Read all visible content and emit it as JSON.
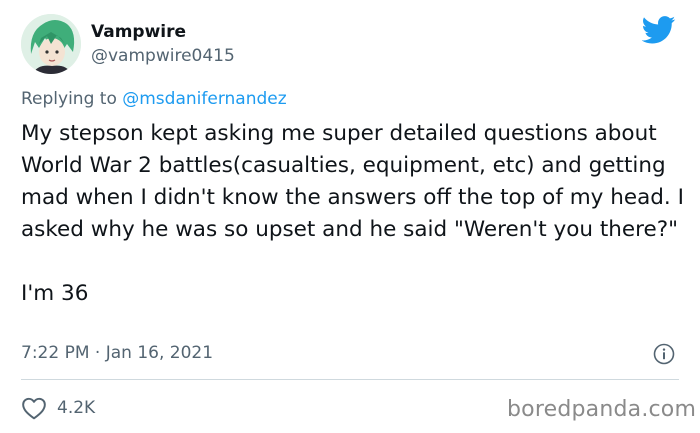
{
  "author": {
    "display_name": "Vampwire",
    "handle": "@vampwire0415"
  },
  "reply": {
    "prefix": "Replying to",
    "mention": "@msdanifernandez"
  },
  "tweet": {
    "text": "My stepson kept asking me super detailed questions about World War 2 battles(casualties, equipment, etc) and getting mad when I didn't know the answers off the top of my head. I asked why he was so upset and he said \"Weren't you there?\"\n\nI'm 36",
    "timestamp": "7:22 PM · Jan 16, 2021",
    "like_count": "4.2K"
  },
  "watermark": "boredpanda.com",
  "colors": {
    "brand": "#1d9bf0",
    "text": "#0f1419",
    "muted": "#536471",
    "divider": "#cfd9de"
  },
  "icons": {
    "logo": "twitter-bird-icon",
    "info": "info-icon",
    "like": "heart-icon"
  }
}
